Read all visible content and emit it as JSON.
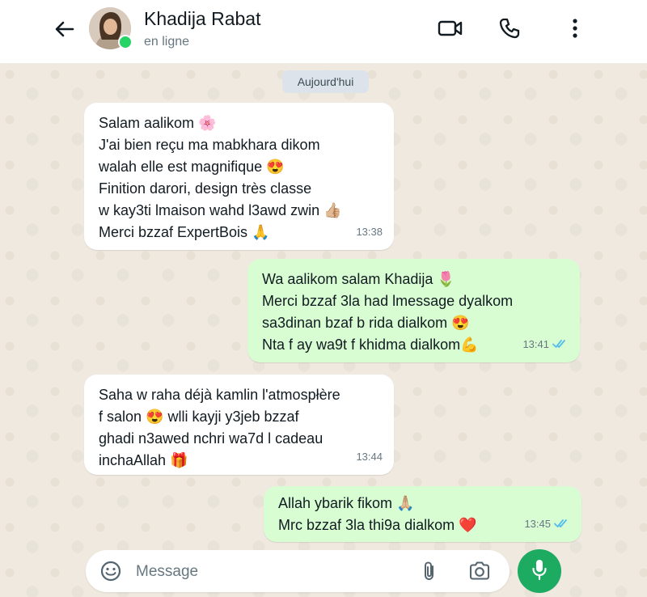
{
  "header": {
    "contact_name": "Khadija Rabat",
    "status": "en ligne",
    "icons": [
      "back-arrow-icon",
      "video-call-icon",
      "phone-icon",
      "more-options-icon"
    ]
  },
  "date_chip": "Aujourd'hui",
  "messages": [
    {
      "direction": "incoming",
      "text": "Salam aalikom 🌸\nJ'ai bien reçu ma mabkhara dikom\nwalah elle est magnifique 😍\nFinition darori, design très classe\nw kay3ti lmaison wahd l3awd zwin 👍🏼\nMerci bzzaf ExpertBois 🙏",
      "time": "13:38"
    },
    {
      "direction": "outgoing",
      "text": "Wa aalikom salam Khadija 🌷\nMerci bzzaf 3la had lmessage dyalkom\nsa3dinan bzaf b rida dialkom 😍\nNta f ay wa9t f khidma dialkom💪",
      "time": "13:41",
      "receipt": "read"
    },
    {
      "direction": "incoming",
      "text": "Saha w raha déjà kamlin l'atmospłère\nf salon 😍 wlli kayji y3jeb bzzaf\nghadi n3awed nchri wa7d l cadeau\ninchaAllah 🎁",
      "time": "13:44"
    },
    {
      "direction": "outgoing",
      "text": "Allah ybarik fikom 🙏🏼\nMrc bzzaf 3la thi9a dialkom ❤️",
      "time": "13:45",
      "receipt": "read"
    }
  ],
  "composer": {
    "placeholder": "Message",
    "icons": [
      "emoji-icon",
      "attach-icon",
      "camera-icon",
      "mic-icon"
    ]
  },
  "colors": {
    "accent_green": "#1daa61",
    "outgoing_bubble": "#d9fdd3",
    "incoming_bubble": "#ffffff",
    "read_receipt": "#53bdeb",
    "chat_background": "#efe9df"
  }
}
